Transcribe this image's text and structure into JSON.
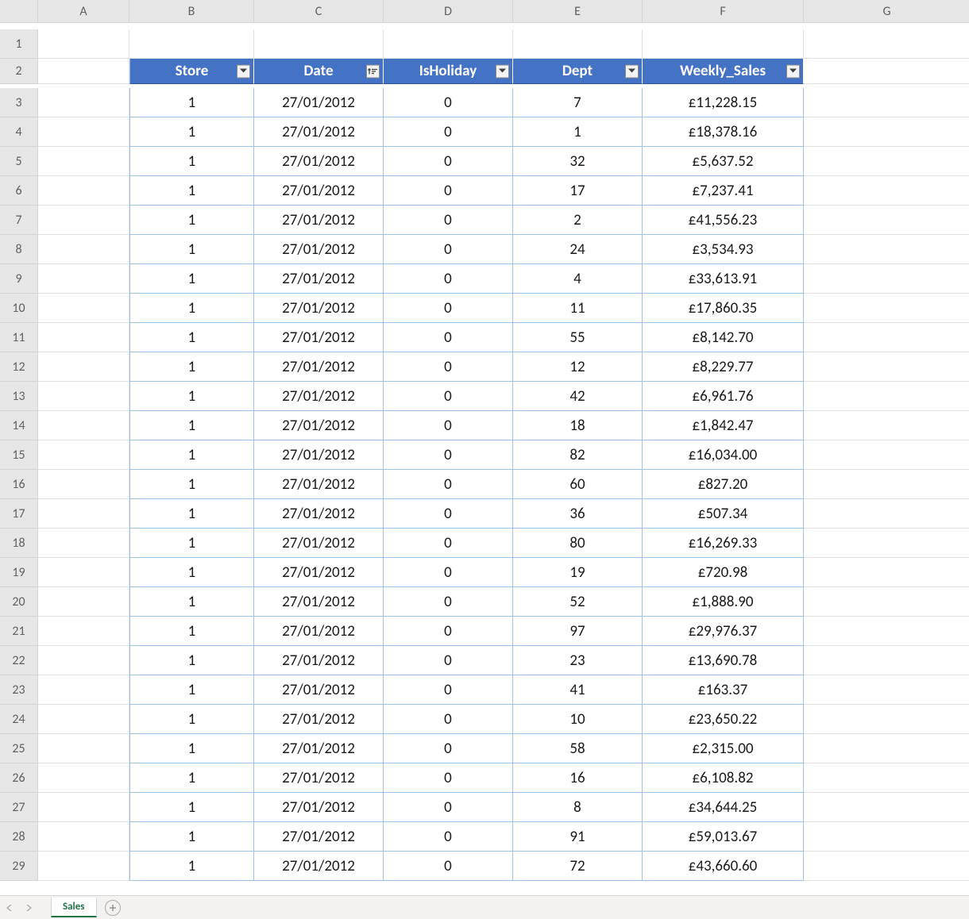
{
  "columns": [
    "A",
    "B",
    "C",
    "D",
    "E",
    "F",
    "G"
  ],
  "rowCount": 29,
  "tableHeaderRow": 2,
  "headers": [
    "Store",
    "Date",
    "IsHoliday",
    "Dept",
    "Weekly_Sales"
  ],
  "sortedColumnIndex": 1,
  "rows": [
    {
      "store": "1",
      "date": "27/01/2012",
      "holiday": "0",
      "dept": "7",
      "sales": "£11,228.15"
    },
    {
      "store": "1",
      "date": "27/01/2012",
      "holiday": "0",
      "dept": "1",
      "sales": "£18,378.16"
    },
    {
      "store": "1",
      "date": "27/01/2012",
      "holiday": "0",
      "dept": "32",
      "sales": "£5,637.52"
    },
    {
      "store": "1",
      "date": "27/01/2012",
      "holiday": "0",
      "dept": "17",
      "sales": "£7,237.41"
    },
    {
      "store": "1",
      "date": "27/01/2012",
      "holiday": "0",
      "dept": "2",
      "sales": "£41,556.23"
    },
    {
      "store": "1",
      "date": "27/01/2012",
      "holiday": "0",
      "dept": "24",
      "sales": "£3,534.93"
    },
    {
      "store": "1",
      "date": "27/01/2012",
      "holiday": "0",
      "dept": "4",
      "sales": "£33,613.91"
    },
    {
      "store": "1",
      "date": "27/01/2012",
      "holiday": "0",
      "dept": "11",
      "sales": "£17,860.35"
    },
    {
      "store": "1",
      "date": "27/01/2012",
      "holiday": "0",
      "dept": "55",
      "sales": "£8,142.70"
    },
    {
      "store": "1",
      "date": "27/01/2012",
      "holiday": "0",
      "dept": "12",
      "sales": "£8,229.77"
    },
    {
      "store": "1",
      "date": "27/01/2012",
      "holiday": "0",
      "dept": "42",
      "sales": "£6,961.76"
    },
    {
      "store": "1",
      "date": "27/01/2012",
      "holiday": "0",
      "dept": "18",
      "sales": "£1,842.47"
    },
    {
      "store": "1",
      "date": "27/01/2012",
      "holiday": "0",
      "dept": "82",
      "sales": "£16,034.00"
    },
    {
      "store": "1",
      "date": "27/01/2012",
      "holiday": "0",
      "dept": "60",
      "sales": "£827.20"
    },
    {
      "store": "1",
      "date": "27/01/2012",
      "holiday": "0",
      "dept": "36",
      "sales": "£507.34"
    },
    {
      "store": "1",
      "date": "27/01/2012",
      "holiday": "0",
      "dept": "80",
      "sales": "£16,269.33"
    },
    {
      "store": "1",
      "date": "27/01/2012",
      "holiday": "0",
      "dept": "19",
      "sales": "£720.98"
    },
    {
      "store": "1",
      "date": "27/01/2012",
      "holiday": "0",
      "dept": "52",
      "sales": "£1,888.90"
    },
    {
      "store": "1",
      "date": "27/01/2012",
      "holiday": "0",
      "dept": "97",
      "sales": "£29,976.37"
    },
    {
      "store": "1",
      "date": "27/01/2012",
      "holiday": "0",
      "dept": "23",
      "sales": "£13,690.78"
    },
    {
      "store": "1",
      "date": "27/01/2012",
      "holiday": "0",
      "dept": "41",
      "sales": "£163.37"
    },
    {
      "store": "1",
      "date": "27/01/2012",
      "holiday": "0",
      "dept": "10",
      "sales": "£23,650.22"
    },
    {
      "store": "1",
      "date": "27/01/2012",
      "holiday": "0",
      "dept": "58",
      "sales": "£2,315.00"
    },
    {
      "store": "1",
      "date": "27/01/2012",
      "holiday": "0",
      "dept": "16",
      "sales": "£6,108.82"
    },
    {
      "store": "1",
      "date": "27/01/2012",
      "holiday": "0",
      "dept": "8",
      "sales": "£34,644.25"
    },
    {
      "store": "1",
      "date": "27/01/2012",
      "holiday": "0",
      "dept": "91",
      "sales": "£59,013.67"
    },
    {
      "store": "1",
      "date": "27/01/2012",
      "holiday": "0",
      "dept": "72",
      "sales": "£43,660.60"
    }
  ],
  "sheetTab": "Sales"
}
